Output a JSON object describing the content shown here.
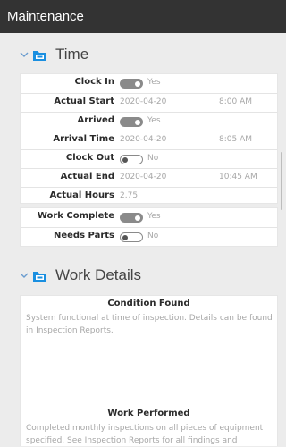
{
  "app": {
    "title": "Maintenance"
  },
  "time_section": {
    "title": "Time",
    "clock_in": {
      "label": "Clock In",
      "state": "Yes",
      "on": true
    },
    "actual_start": {
      "label": "Actual Start",
      "date": "2020-04-20",
      "time": "8:00 AM"
    },
    "arrived": {
      "label": "Arrived",
      "state": "Yes",
      "on": true
    },
    "arrival_time": {
      "label": "Arrival Time",
      "date": "2020-04-20",
      "time": "8:05 AM"
    },
    "clock_out": {
      "label": "Clock Out",
      "state": "No",
      "on": false
    },
    "actual_end": {
      "label": "Actual End",
      "date": "2020-04-20",
      "time": "10:45 AM"
    },
    "actual_hours": {
      "label": "Actual Hours",
      "value": "2.75"
    },
    "work_complete": {
      "label": "Work Complete",
      "state": "Yes",
      "on": true
    },
    "needs_parts": {
      "label": "Needs Parts",
      "state": "No",
      "on": false
    }
  },
  "work_details_section": {
    "title": "Work Details",
    "condition_found": {
      "label": "Condition Found",
      "text": "System functional at time of inspection. Details can be found in Inspection Reports."
    },
    "work_performed": {
      "label": "Work Performed",
      "text": "Completed monthly inspections on all pieces of equipment specified. See Inspection Reports for all findings and"
    }
  },
  "colors": {
    "topbar": "#333333",
    "folder_icon": "#1a8fe0",
    "toggle": "#8a8a8a"
  },
  "icons": {
    "expand": "chevron-down-icon",
    "section": "folder-icon"
  }
}
